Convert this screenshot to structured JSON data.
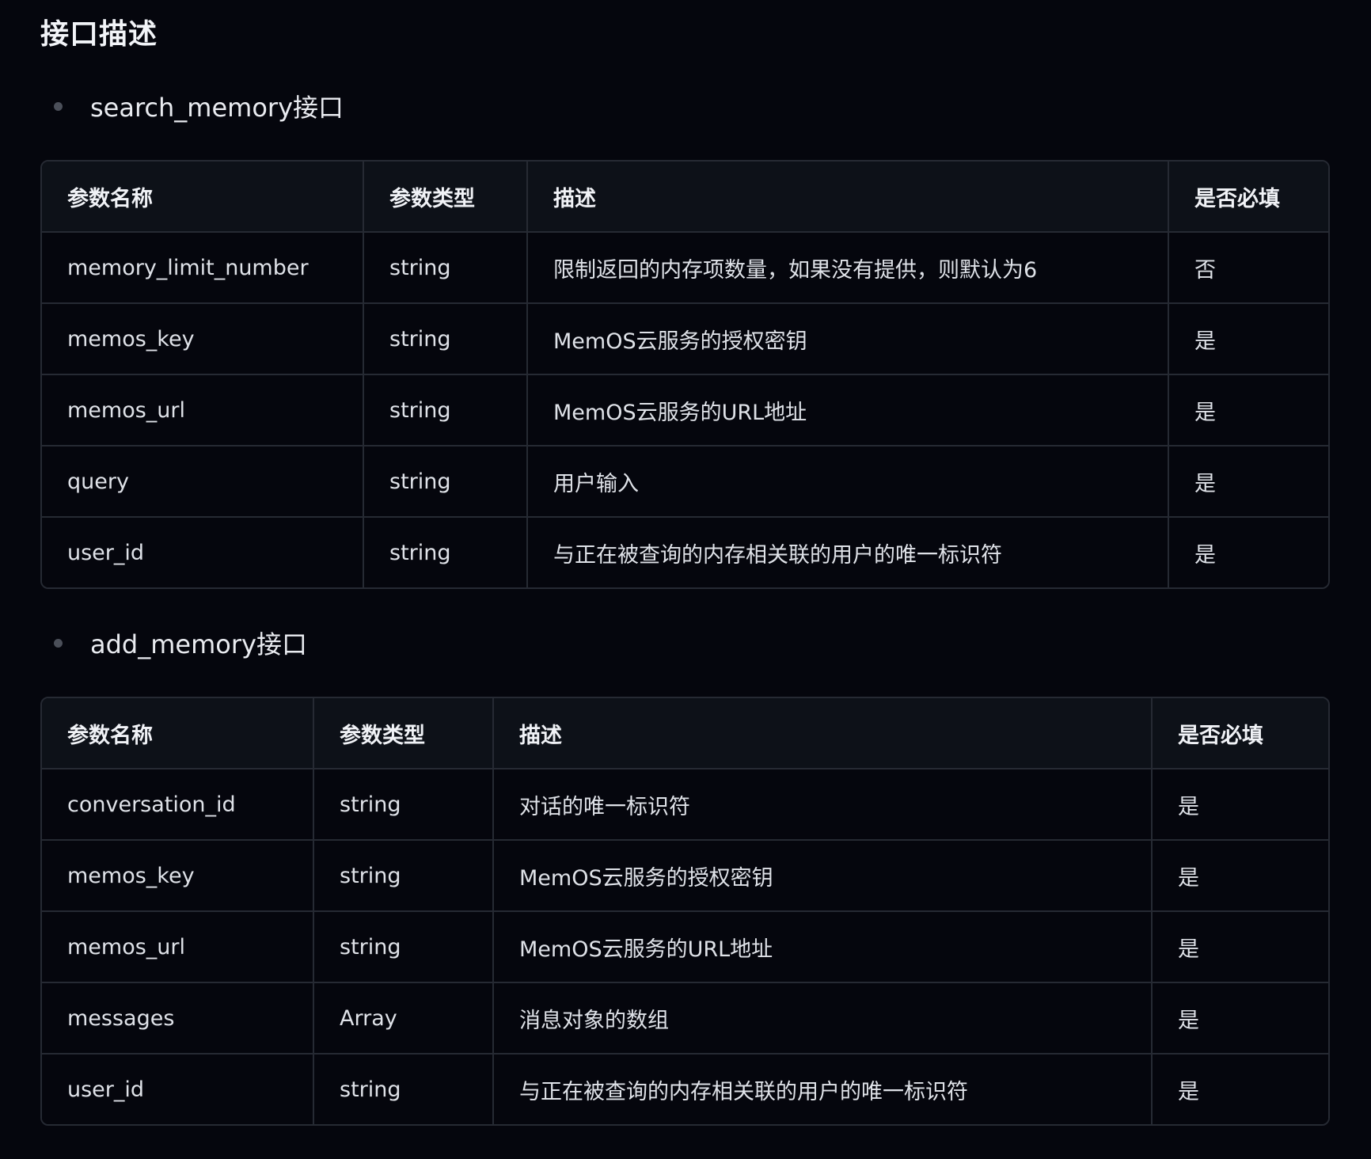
{
  "title": "接口描述",
  "sections": [
    {
      "name": "search_memory接口",
      "headers": [
        "参数名称",
        "参数类型",
        "描述",
        "是否必填"
      ],
      "rows": [
        [
          "memory_limit_number",
          "string",
          "限制返回的内存项数量，如果没有提供，则默认为6",
          "否"
        ],
        [
          "memos_key",
          "string",
          "MemOS云服务的授权密钥",
          "是"
        ],
        [
          "memos_url",
          "string",
          "MemOS云服务的URL地址",
          "是"
        ],
        [
          "query",
          "string",
          "用户输入",
          "是"
        ],
        [
          "user_id",
          "string",
          "与正在被查询的内存相关联的用户的唯一标识符",
          "是"
        ]
      ]
    },
    {
      "name": "add_memory接口",
      "headers": [
        "参数名称",
        "参数类型",
        "描述",
        "是否必填"
      ],
      "rows": [
        [
          "conversation_id",
          "string",
          "对话的唯一标识符",
          "是"
        ],
        [
          "memos_key",
          "string",
          "MemOS云服务的授权密钥",
          "是"
        ],
        [
          "memos_url",
          "string",
          "MemOS云服务的URL地址",
          "是"
        ],
        [
          "messages",
          "Array",
          "消息对象的数组",
          "是"
        ],
        [
          "user_id",
          "string",
          "与正在被查询的内存相关联的用户的唯一标识符",
          "是"
        ]
      ]
    }
  ]
}
